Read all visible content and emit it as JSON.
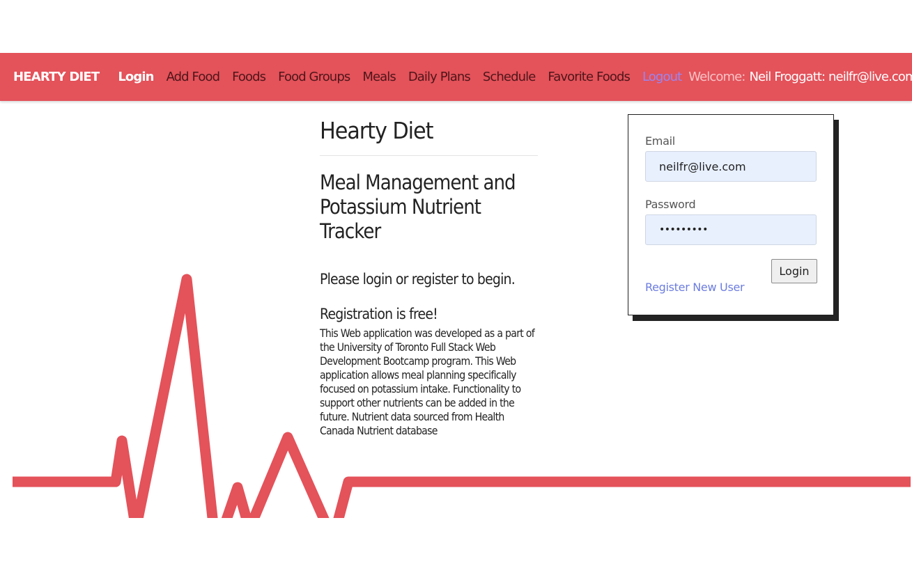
{
  "colors": {
    "navbar_background": "#e4525a",
    "heartbeat_line": "#e4525a",
    "logout_link": "#9b85f0",
    "register_link": "#6c7ddf",
    "input_background": "#e8f0fe"
  },
  "navbar": {
    "brand": "HEARTY DIET",
    "links": [
      {
        "label": "Login",
        "active": true
      },
      {
        "label": "Add Food"
      },
      {
        "label": "Foods"
      },
      {
        "label": "Food Groups"
      },
      {
        "label": "Meals"
      },
      {
        "label": "Daily Plans"
      },
      {
        "label": "Schedule"
      },
      {
        "label": "Favorite Foods"
      }
    ],
    "logout": "Logout",
    "welcome_label": "Welcome:",
    "welcome_user": "Neil Froggatt: neilfr@live.com"
  },
  "main": {
    "title": "Hearty Diet",
    "subtitle": "Meal Management and Potassium Nutrient Tracker",
    "prompt": "Please login or register to begin.",
    "free_note": "Registration is free!",
    "description": "This Web application was developed as a part of the University of Toronto Full Stack Web Development Bootcamp program. This Web application allows meal planning specifically focused on potassium intake. Functionality to support other nutrients can be added in the future. Nutrient data sourced from Health Canada Nutrient database"
  },
  "login_form": {
    "email_label": "Email",
    "email_value": "neilfr@live.com",
    "password_label": "Password",
    "password_value": "•••••••••",
    "login_button": "Login",
    "register_link": "Register New User"
  }
}
